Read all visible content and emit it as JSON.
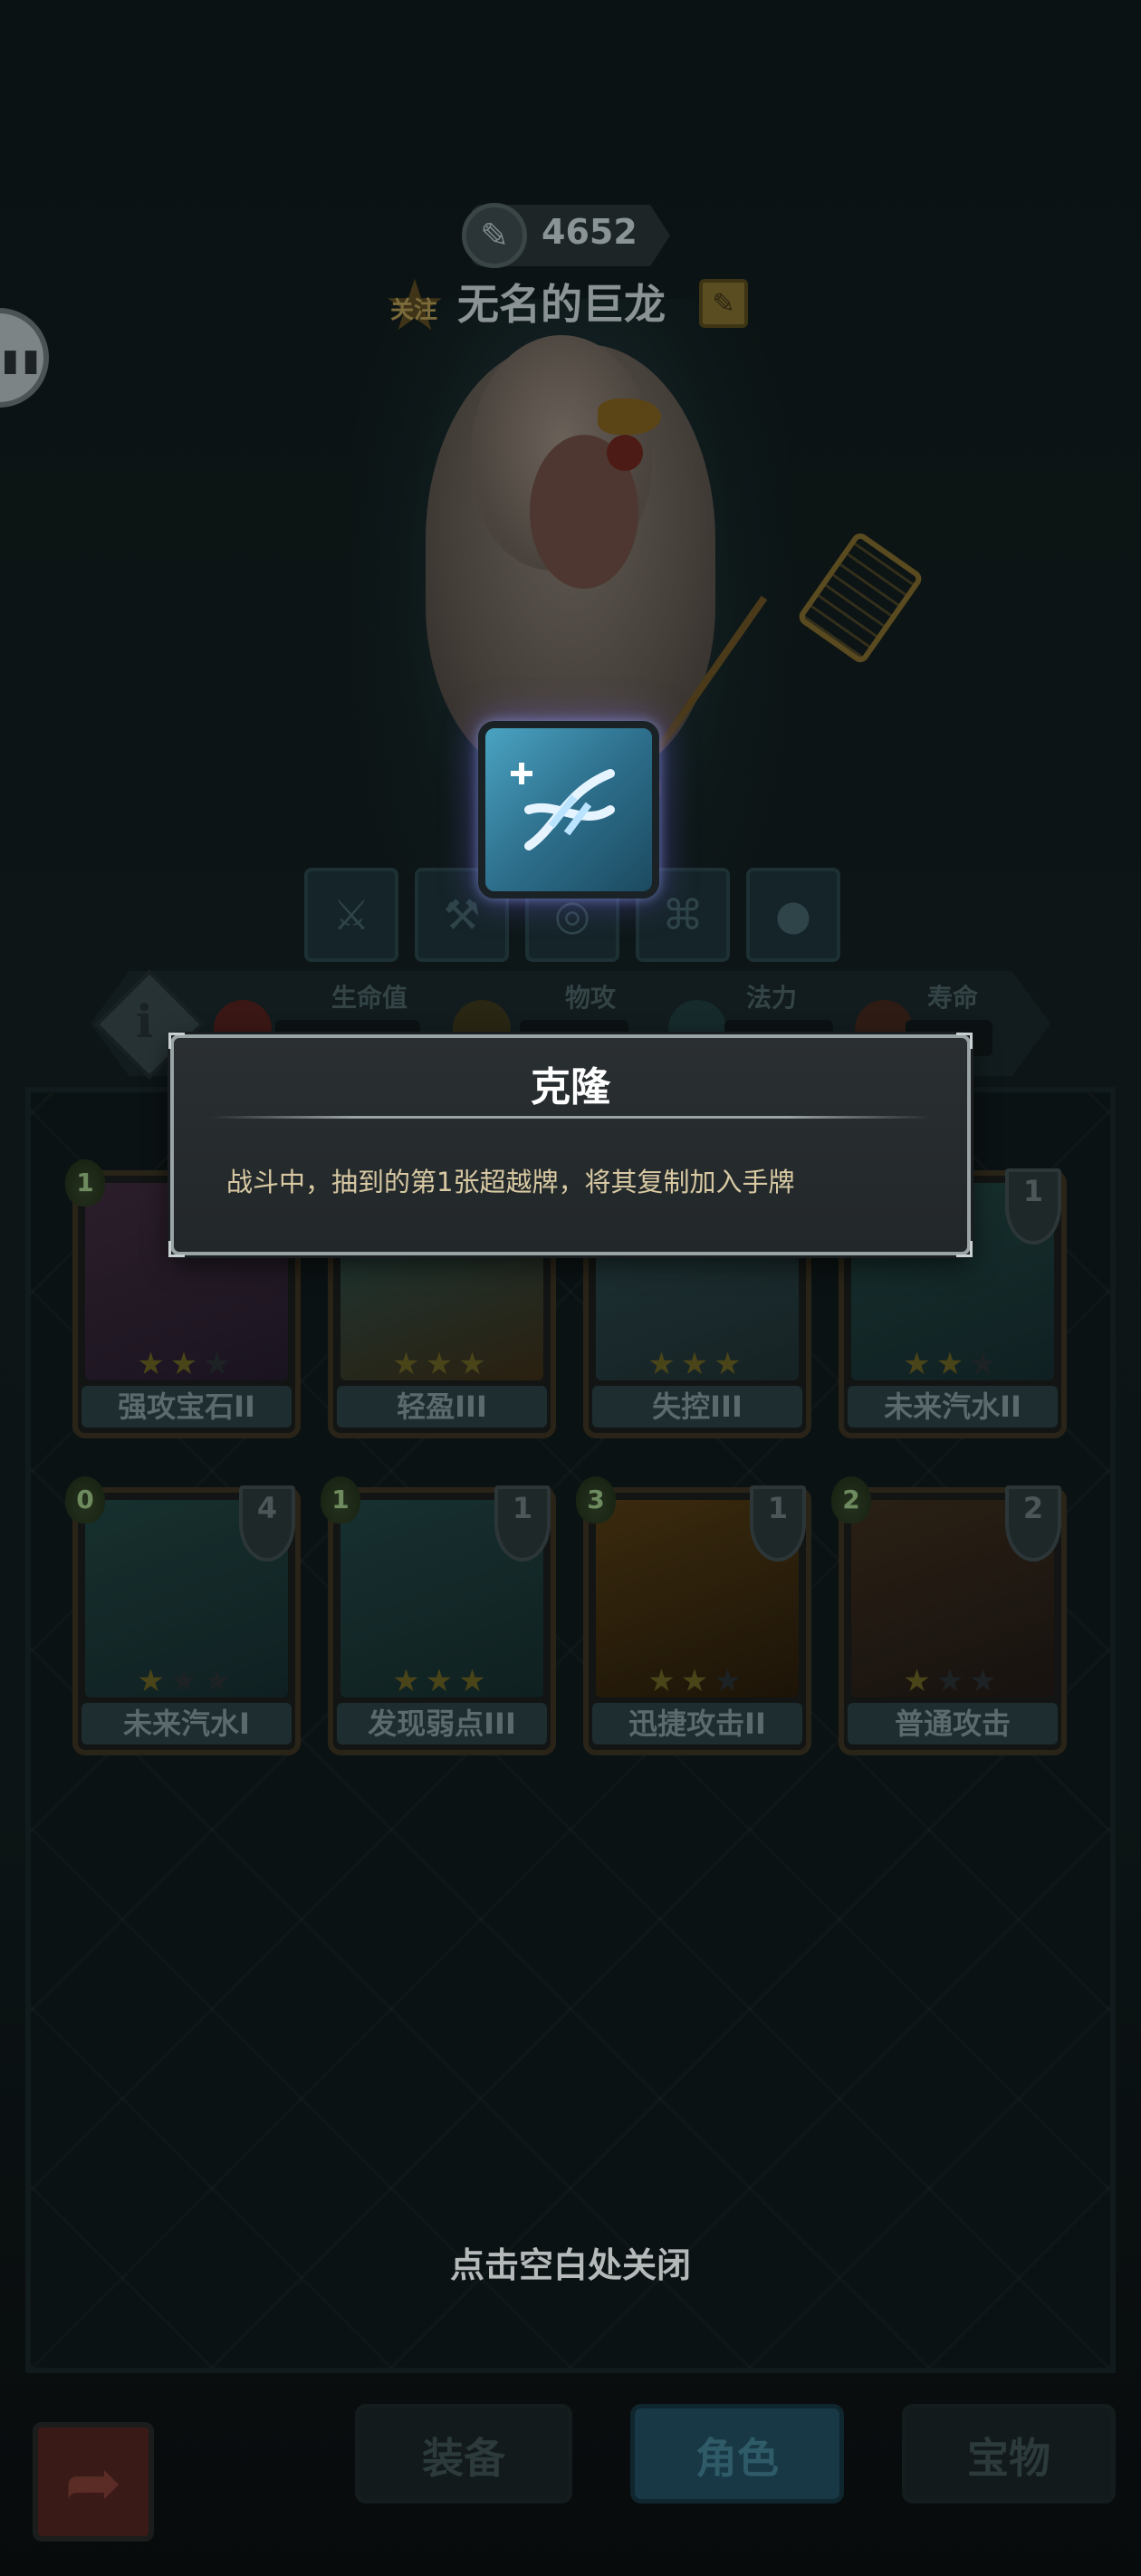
{
  "header": {
    "score": "4652",
    "follow_label": "关注",
    "player_name": "无名的巨龙"
  },
  "stats": {
    "hp_label": "生命值",
    "attack_label": "物攻",
    "magic_label": "法力",
    "lifespan_label": "寿命"
  },
  "modal": {
    "title": "克隆",
    "description": "战斗中，抽到的第1张超越牌，将其复制加入手牌"
  },
  "cards": [
    {
      "name": "强攻宝石II",
      "cost": "1",
      "stack": "",
      "stars_filled": 2,
      "stars_total": 3
    },
    {
      "name": "轻盈III",
      "cost": "",
      "stack": "",
      "stars_filled": 3,
      "stars_total": 3
    },
    {
      "name": "失控III",
      "cost": "",
      "stack": "",
      "stars_filled": 3,
      "stars_total": 3
    },
    {
      "name": "未来汽水II",
      "cost": "",
      "stack": "1",
      "stars_filled": 2,
      "stars_total": 3
    },
    {
      "name": "未来汽水I",
      "cost": "0",
      "stack": "4",
      "stars_filled": 1,
      "stars_total": 3
    },
    {
      "name": "发现弱点III",
      "cost": "1",
      "stack": "1",
      "stars_filled": 3,
      "stars_total": 3
    },
    {
      "name": "迅捷攻击II",
      "cost": "3",
      "stack": "1",
      "stars_filled": 2,
      "stars_total": 3
    },
    {
      "name": "普通攻击",
      "cost": "2",
      "stack": "2",
      "stars_filled": 1,
      "stars_total": 3
    }
  ],
  "close_hint": "点击空白处关闭",
  "nav": {
    "equip": "装备",
    "role": "角色",
    "treasure": "宝物"
  },
  "colors": {
    "modal_title": "#ffffff",
    "modal_text": "#d8c9a3",
    "skill_icon": "#4aa3c2"
  },
  "icons": [
    "pen-icon",
    "edit-icon",
    "info-icon",
    "back-arrow-icon",
    "heart-icon",
    "sword-icon",
    "flask-icon",
    "dna-icon",
    "star-icon",
    "stack-icon",
    "drop-icon"
  ]
}
